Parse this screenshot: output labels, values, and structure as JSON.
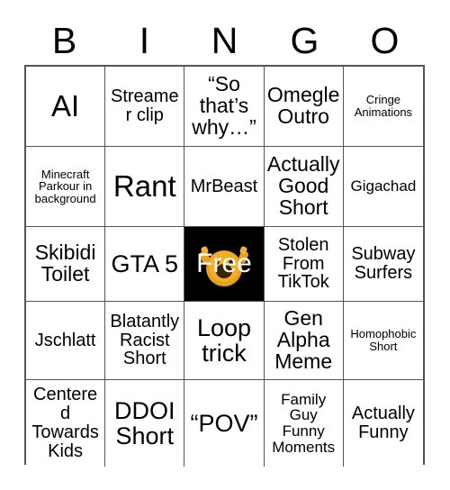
{
  "card": {
    "header_letters": [
      "B",
      "I",
      "N",
      "G",
      "O"
    ],
    "free_space": {
      "label": "Free",
      "icon": "raising-hands-emoji",
      "background_color": "#000000",
      "label_color": "#ffffff",
      "emoji_color": "#e8a020"
    },
    "grid_border_color": "#555555",
    "rows": [
      [
        {
          "text": "AI",
          "size": "xxl"
        },
        {
          "text": "Streamer clip",
          "size": "md"
        },
        {
          "text": "“So that’s why…”",
          "size": "lg"
        },
        {
          "text": "Omegle Outro",
          "size": "lg"
        },
        {
          "text": "Cringe Animations",
          "size": "xs"
        }
      ],
      [
        {
          "text": "Minecraft Parkour in background",
          "size": "xs"
        },
        {
          "text": "Rant",
          "size": "xxl"
        },
        {
          "text": "MrBeast",
          "size": "md"
        },
        {
          "text": "Actually Good Short",
          "size": "lg"
        },
        {
          "text": "Gigachad",
          "size": "sm"
        }
      ],
      [
        {
          "text": "Skibidi Toilet",
          "size": "lg"
        },
        {
          "text": "GTA 5",
          "size": "xl"
        },
        {
          "text": "Free",
          "size": "xl",
          "free": true
        },
        {
          "text": "Stolen From TikTok",
          "size": "md"
        },
        {
          "text": "Subway Surfers",
          "size": "md"
        }
      ],
      [
        {
          "text": "Jschlatt",
          "size": "md"
        },
        {
          "text": "Blatantly Racist Short",
          "size": "md"
        },
        {
          "text": "Loop trick",
          "size": "xl"
        },
        {
          "text": "Gen Alpha Meme",
          "size": "lg"
        },
        {
          "text": "Homophobic Short",
          "size": "xs"
        }
      ],
      [
        {
          "text": "Centered Towards Kids",
          "size": "md"
        },
        {
          "text": "DDOI Short",
          "size": "xl"
        },
        {
          "text": "“POV”",
          "size": "xl"
        },
        {
          "text": "Family Guy Funny Moments",
          "size": "sm"
        },
        {
          "text": "Actually Funny",
          "size": "md"
        }
      ]
    ]
  }
}
